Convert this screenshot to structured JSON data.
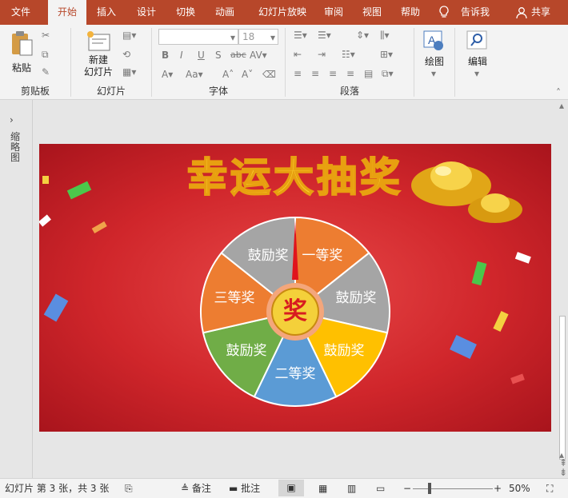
{
  "tabs": [
    "文件",
    "开始",
    "插入",
    "设计",
    "切换",
    "动画",
    "幻灯片放映",
    "审阅",
    "视图",
    "帮助"
  ],
  "tell_me": "告诉我",
  "share": "共享",
  "ribbon": {
    "clipboard": {
      "label": "剪贴板",
      "paste": "粘贴"
    },
    "slides": {
      "label": "幻灯片",
      "new_slide": "新建\n幻灯片"
    },
    "font": {
      "label": "字体",
      "size": "18"
    },
    "paragraph": {
      "label": "段落"
    },
    "drawing": {
      "label": "绘图"
    },
    "editing": {
      "label": "编辑"
    }
  },
  "left_pane": {
    "label": "缩略图"
  },
  "slide": {
    "title": "幸运大抽奖",
    "center": "奖",
    "segments": [
      "一等奖",
      "鼓励奖",
      "鼓励奖",
      "二等奖",
      "鼓励奖",
      "三等奖",
      "鼓励奖"
    ],
    "colors": [
      "#ed7d31",
      "#a5a5a5",
      "#ffc000",
      "#5b9bd5",
      "#70ad47",
      "#ed7d31",
      "#a5a5a5"
    ]
  },
  "status": {
    "slide": "幻灯片 第 3 张，共 3 张",
    "notes": "备注",
    "comments": "批注",
    "zoom": "50%"
  }
}
